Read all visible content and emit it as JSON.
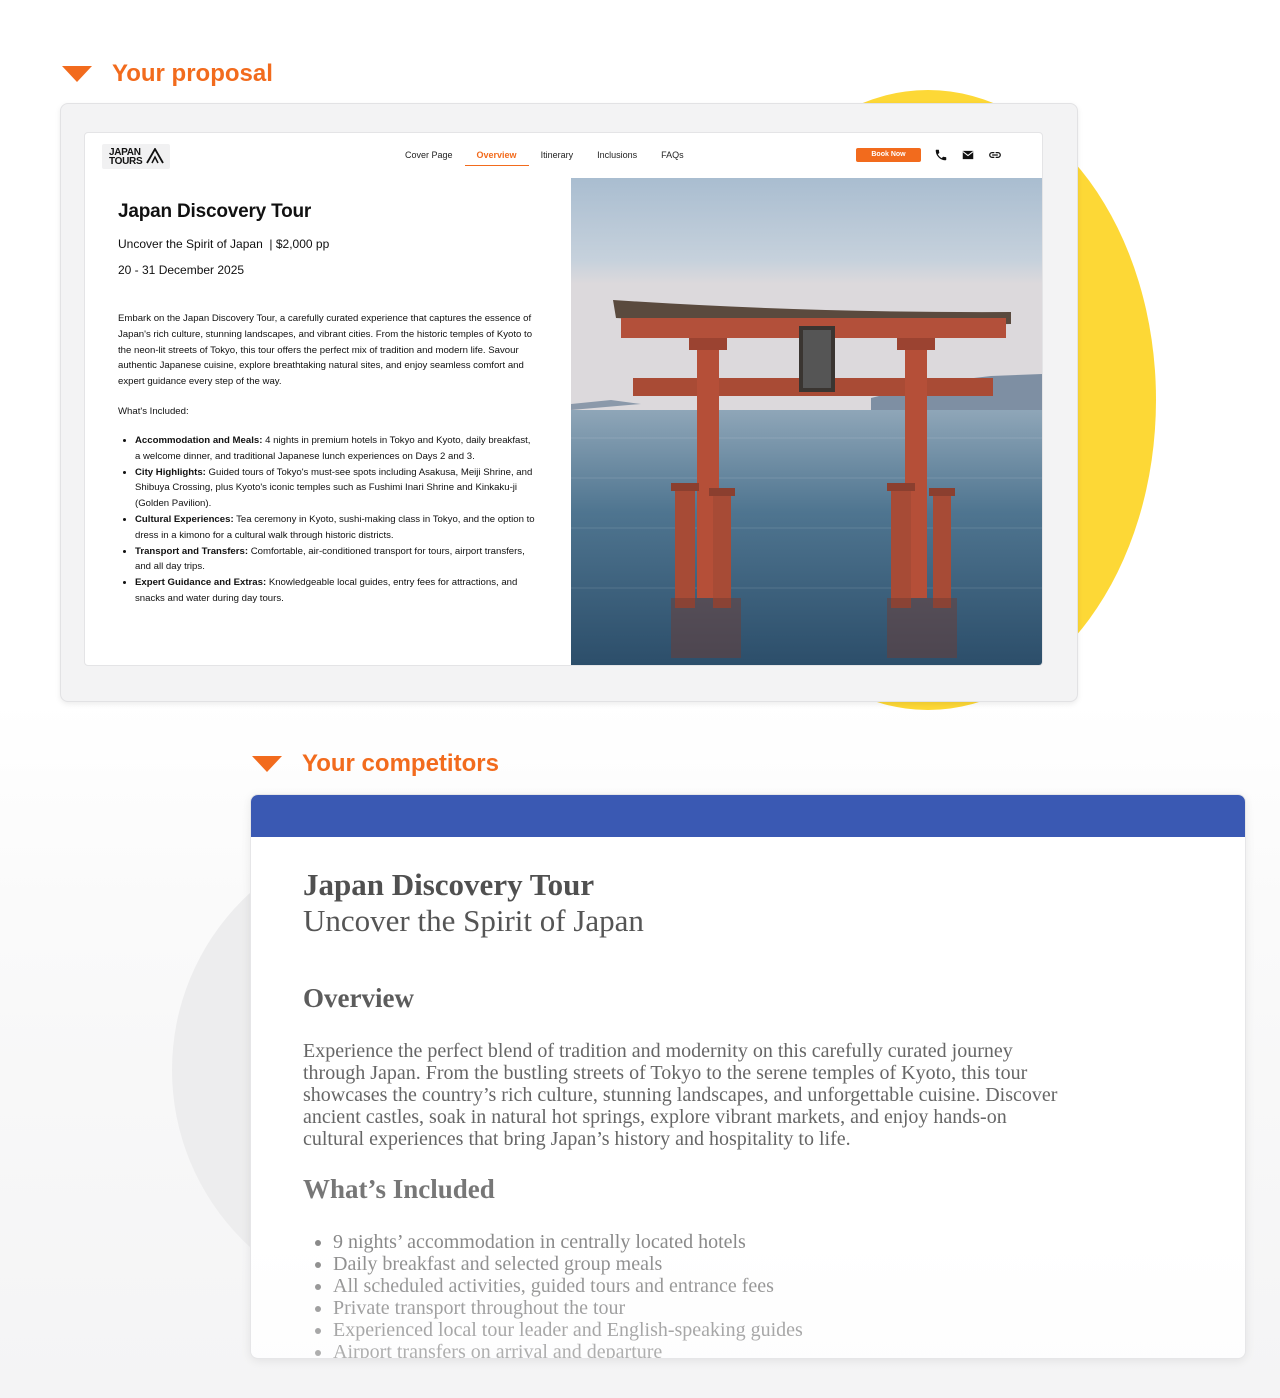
{
  "sections": {
    "proposal_label": "Your proposal",
    "competitors_label": "Your competitors"
  },
  "colors": {
    "accent_orange": "#f26b1d",
    "yellow": "#fdd836",
    "competitor_header_blue": "#3a59b3"
  },
  "proposal": {
    "logo": {
      "line1": "JAPAN",
      "line2": "TOURS"
    },
    "nav": {
      "tabs": [
        {
          "label": "Cover Page",
          "active": false
        },
        {
          "label": "Overview",
          "active": true
        },
        {
          "label": "Itinerary",
          "active": false
        },
        {
          "label": "Inclusions",
          "active": false
        },
        {
          "label": "FAQs",
          "active": false
        }
      ],
      "book_label": "Book Now",
      "icons": [
        "phone-icon",
        "mail-icon",
        "link-icon"
      ]
    },
    "title": "Japan Discovery Tour",
    "subtitle": "Uncover the Spirit of Japan  | $2,000 pp",
    "dates": "20 - 31 December 2025",
    "description": "Embark on the Japan Discovery Tour, a carefully curated experience that captures the essence of Japan's rich culture, stunning landscapes, and vibrant cities. From the historic temples of Kyoto to the neon-lit streets of Tokyo, this tour offers the perfect mix of tradition and modern life. Savour authentic Japanese cuisine, explore breathtaking natural sites, and enjoy seamless comfort and expert guidance every step of the way.",
    "included_heading": "What's Included:",
    "included": [
      {
        "label": "Accommodation and Meals:",
        "text": " 4 nights in premium hotels in Tokyo and Kyoto, daily breakfast, a welcome dinner, and traditional Japanese lunch experiences on Days 2 and 3."
      },
      {
        "label": "City Highlights:",
        "text": " Guided tours of Tokyo's must-see spots including Asakusa, Meiji Shrine, and Shibuya Crossing, plus Kyoto's iconic temples such as Fushimi Inari Shrine and Kinkaku-ji (Golden Pavilion)."
      },
      {
        "label": "Cultural Experiences:",
        "text": " Tea ceremony in Kyoto, sushi-making class in Tokyo, and the option to dress in a kimono for a cultural walk through historic districts."
      },
      {
        "label": "Transport and Transfers:",
        "text": " Comfortable, air-conditioned transport for tours, airport transfers, and all day trips."
      },
      {
        "label": "Expert Guidance and Extras:",
        "text": " Knowledgeable local guides, entry fees for attractions, and snacks and water during day tours."
      }
    ],
    "hero_image": "torii-gate-in-water"
  },
  "competitor": {
    "title": "Japan Discovery Tour",
    "subtitle": "Uncover the Spirit of Japan",
    "overview_heading": "Overview",
    "overview_text": "Experience the perfect blend of tradition and modernity on this carefully curated journey through Japan. From the bustling streets of Tokyo to the serene temples of Kyoto, this tour showcases the country’s rich culture, stunning landscapes, and unforgettable cuisine. Discover ancient castles, soak in natural hot springs, explore vibrant markets, and enjoy hands-on cultural experiences that bring Japan’s history and hospitality to life.",
    "included_heading": "What’s Included",
    "included": [
      "9 nights’ accommodation in centrally located hotels",
      "Daily breakfast and selected group meals",
      "All scheduled activities, guided tours and entrance fees",
      "Private transport throughout the tour",
      "Experienced local tour leader and English-speaking guides",
      "Airport transfers on arrival and departure"
    ]
  }
}
